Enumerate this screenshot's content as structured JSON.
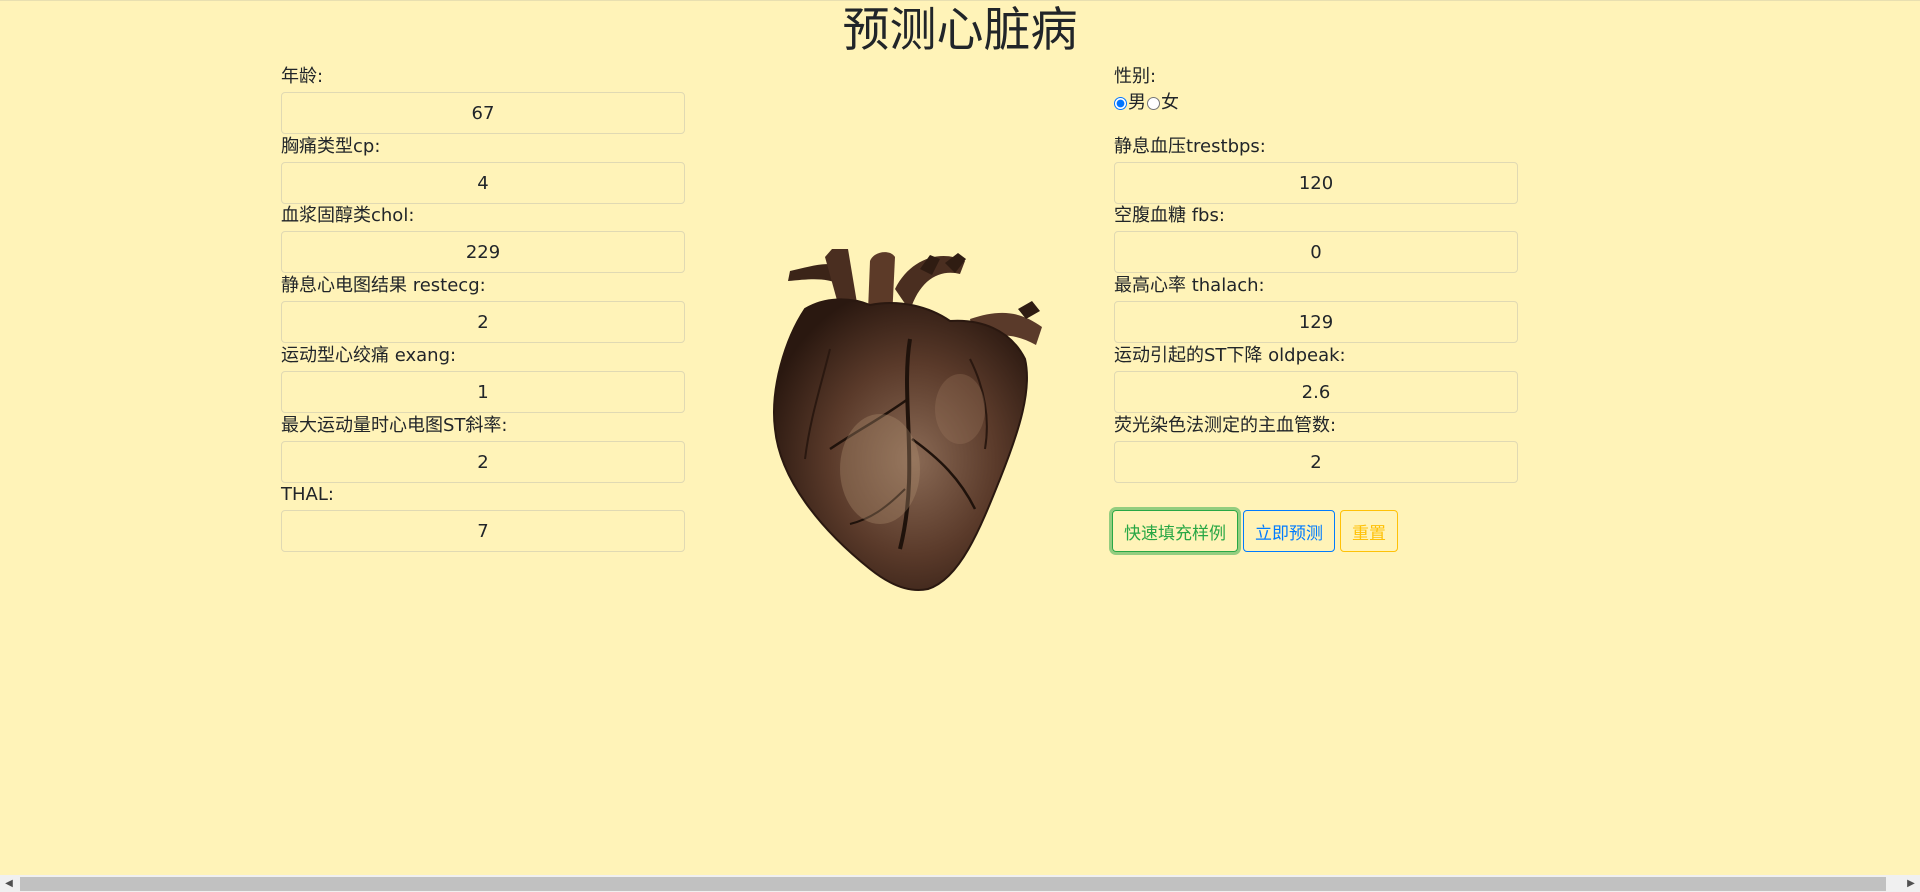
{
  "page": {
    "title": "预测心脏病"
  },
  "form": {
    "left": [
      {
        "label": "年龄:",
        "value": "67"
      },
      {
        "label": "胸痛类型cp:",
        "value": "4"
      },
      {
        "label": "血浆固醇类chol:",
        "value": "229"
      },
      {
        "label": "静息心电图结果 restecg:",
        "value": "2"
      },
      {
        "label": "运动型心绞痛 exang:",
        "value": "1"
      },
      {
        "label": "最大运动量时心电图ST斜率:",
        "value": "2"
      },
      {
        "label": "THAL:",
        "value": "7"
      }
    ],
    "sex": {
      "label": "性别:",
      "options": [
        "男",
        "女"
      ],
      "selected": "男"
    },
    "right": [
      {
        "label": "静息血压trestbps:",
        "value": "120"
      },
      {
        "label": "空腹血糖 fbs:",
        "value": "0"
      },
      {
        "label": "最高心率 thalach:",
        "value": "129"
      },
      {
        "label": "运动引起的ST下降 oldpeak:",
        "value": "2.6"
      },
      {
        "label": "荧光染色法测定的主血管数:",
        "value": "2"
      }
    ]
  },
  "buttons": {
    "quick_fill": "快速填充样例",
    "predict": "立即预测",
    "reset": "重置"
  },
  "image": {
    "icon": "anatomical-heart-illustration"
  },
  "colors": {
    "background": "#fff3b8",
    "success": "#28a745",
    "primary": "#007bff",
    "warning": "#ffc107"
  }
}
